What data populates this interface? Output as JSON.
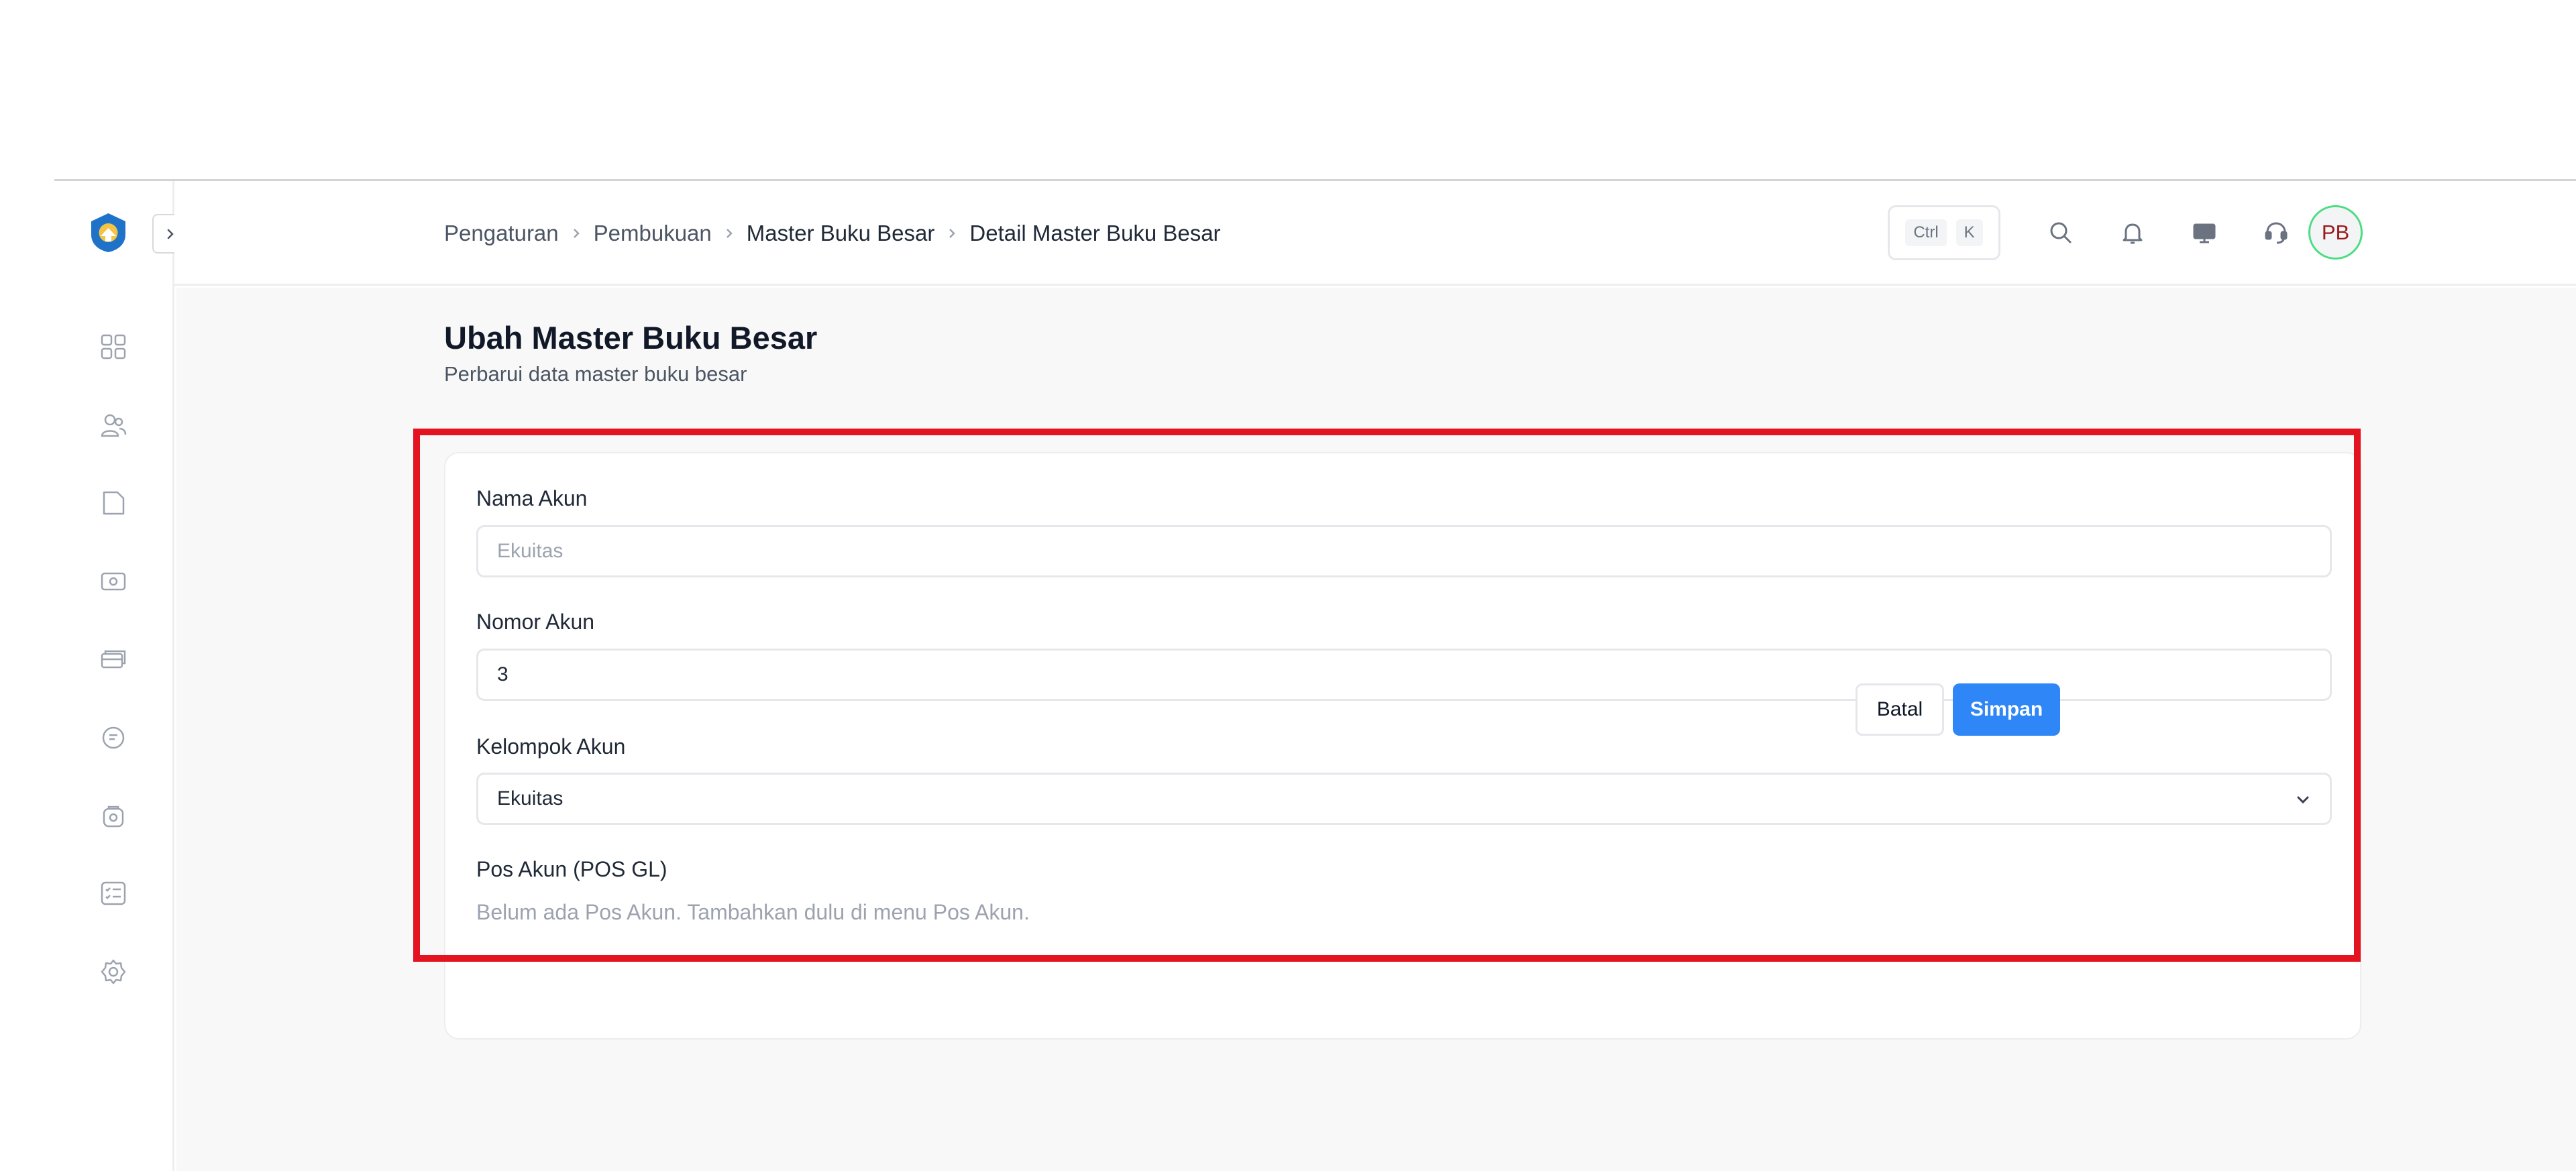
{
  "sidebar": {
    "items": [
      {
        "icon": "dashboard-icon"
      },
      {
        "icon": "users-icon"
      },
      {
        "icon": "folder-icon"
      },
      {
        "icon": "money-icon"
      },
      {
        "icon": "cards-icon"
      },
      {
        "icon": "report-icon"
      },
      {
        "icon": "lock-icon"
      },
      {
        "icon": "checklist-icon"
      },
      {
        "icon": "gear-icon"
      }
    ]
  },
  "header": {
    "breadcrumb": [
      "Pengaturan",
      "Pembukuan",
      "Master Buku Besar",
      "Detail Master Buku Besar"
    ],
    "shortcut": {
      "key1": "Ctrl",
      "key2": "K"
    },
    "avatar_initials": "PB"
  },
  "page": {
    "title": "Ubah Master Buku Besar",
    "subtitle": "Perbarui data master buku besar"
  },
  "form": {
    "nama_akun": {
      "label": "Nama Akun",
      "placeholder": "Ekuitas"
    },
    "nomor_akun": {
      "label": "Nomor Akun",
      "value": "3"
    },
    "kelompok_akun": {
      "label": "Kelompok Akun",
      "value": "Ekuitas"
    },
    "pos_akun": {
      "label": "Pos Akun (POS GL)",
      "hint": "Belum ada Pos Akun. Tambahkan dulu di menu Pos Akun."
    },
    "cancel_label": "Batal",
    "save_label": "Simpan"
  },
  "colors": {
    "primary": "#2f86f6",
    "highlight": "#e3131f",
    "avatar_border": "#4ade80"
  }
}
